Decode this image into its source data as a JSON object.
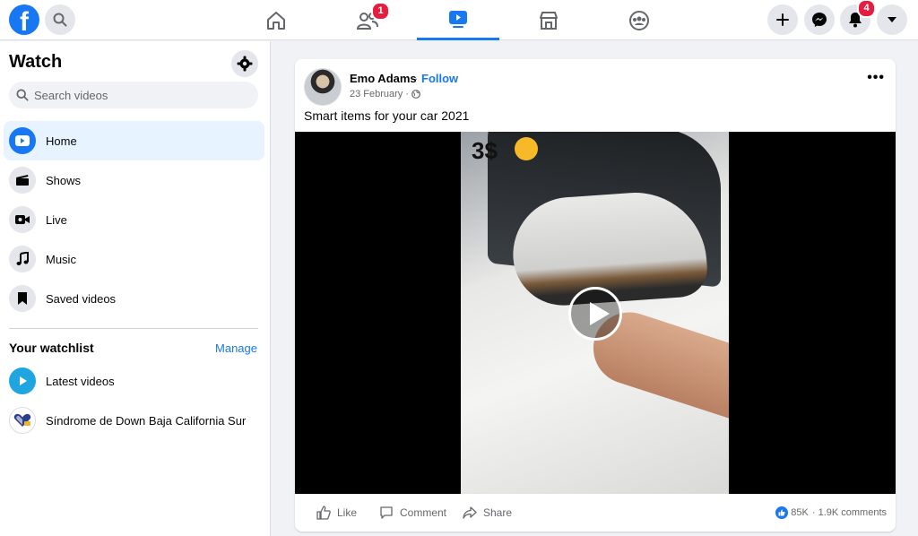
{
  "header": {
    "logo_letter": "f",
    "badges": {
      "friends": "1",
      "notifications": "4"
    }
  },
  "sidebar": {
    "title": "Watch",
    "search_placeholder": "Search videos",
    "items": [
      {
        "label": "Home",
        "icon": "play-icon",
        "active": true
      },
      {
        "label": "Shows",
        "icon": "clapper-icon"
      },
      {
        "label": "Live",
        "icon": "camera-icon"
      },
      {
        "label": "Music",
        "icon": "music-note-icon"
      },
      {
        "label": "Saved videos",
        "icon": "bookmark-icon"
      }
    ],
    "watchlist": {
      "title": "Your watchlist",
      "manage_label": "Manage",
      "items": [
        {
          "label": "Latest videos"
        },
        {
          "label": "Síndrome de Down Baja California Sur"
        }
      ]
    }
  },
  "post": {
    "author": "Emo Adams",
    "separator": "·",
    "follow_label": "Follow",
    "date": "23 February ·",
    "text": "Smart items for your car 2021",
    "video_overlay_text": "3$",
    "actions": {
      "like": "Like",
      "comment": "Comment",
      "share": "Share"
    },
    "reactions_count": "85K",
    "comments_count": "· 1.9K comments"
  },
  "colors": {
    "accent": "#1877f2",
    "badge": "#e41e3f",
    "background": "#f0f2f5"
  }
}
